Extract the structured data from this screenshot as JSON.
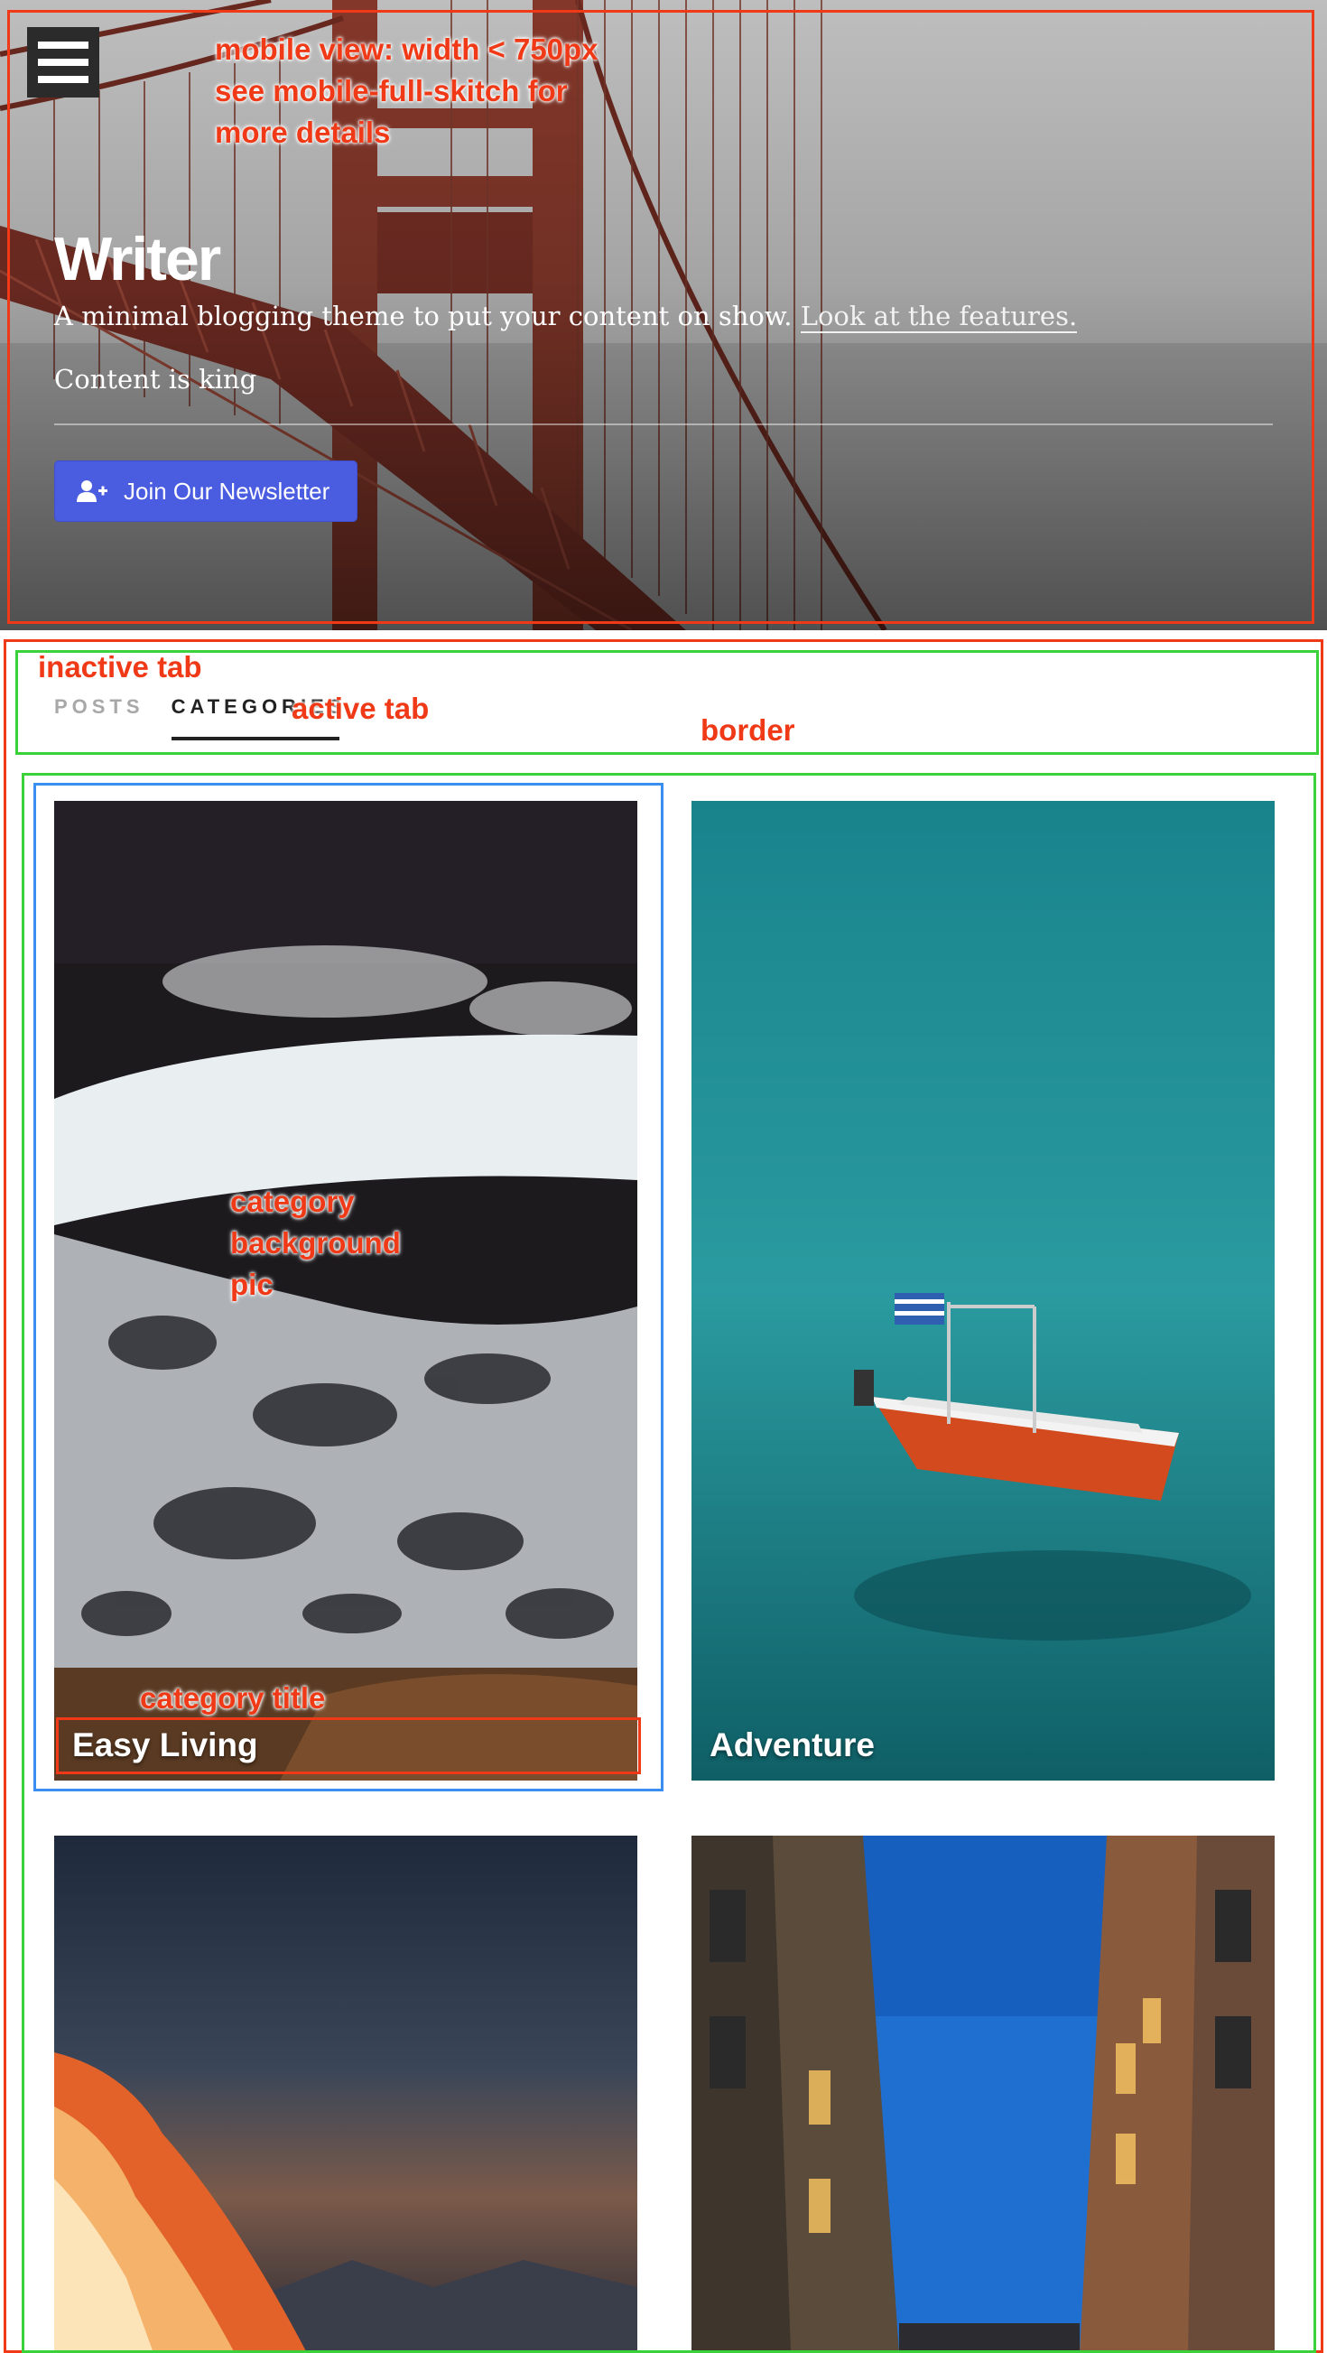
{
  "hero": {
    "menu_icon": "hamburger-menu-icon",
    "title": "Writer",
    "description": "A minimal blogging theme to put your content on show.",
    "description_link": "Look at the features.",
    "tagline": "Content is king",
    "newsletter_button": "Join Our Newsletter",
    "newsletter_icon": "user-plus-icon",
    "button_color": "#4a5ce0"
  },
  "tabs": [
    {
      "label": "POSTS",
      "state": "inactive"
    },
    {
      "label": "CATEGORIES",
      "state": "active"
    }
  ],
  "categories": [
    {
      "title": "Easy Living",
      "image": "ocean waves aerial"
    },
    {
      "title": "Adventure",
      "image": "red boat on teal water"
    },
    {
      "title": "",
      "image": "fire and dusk sky"
    },
    {
      "title": "",
      "image": "narrow street with buildings"
    }
  ],
  "annotations": {
    "mobile_note": "mobile view: width < 750px\nsee mobile-full-skitch for\nmore details",
    "inactive_tab": "inactive tab",
    "active_tab": "active tab",
    "border": "border",
    "category_background": "category\nbackground\npic",
    "category_title": "category title",
    "colors": {
      "red": "#f03a17",
      "green": "#3ad13a",
      "blue": "#3a8ef0"
    }
  }
}
